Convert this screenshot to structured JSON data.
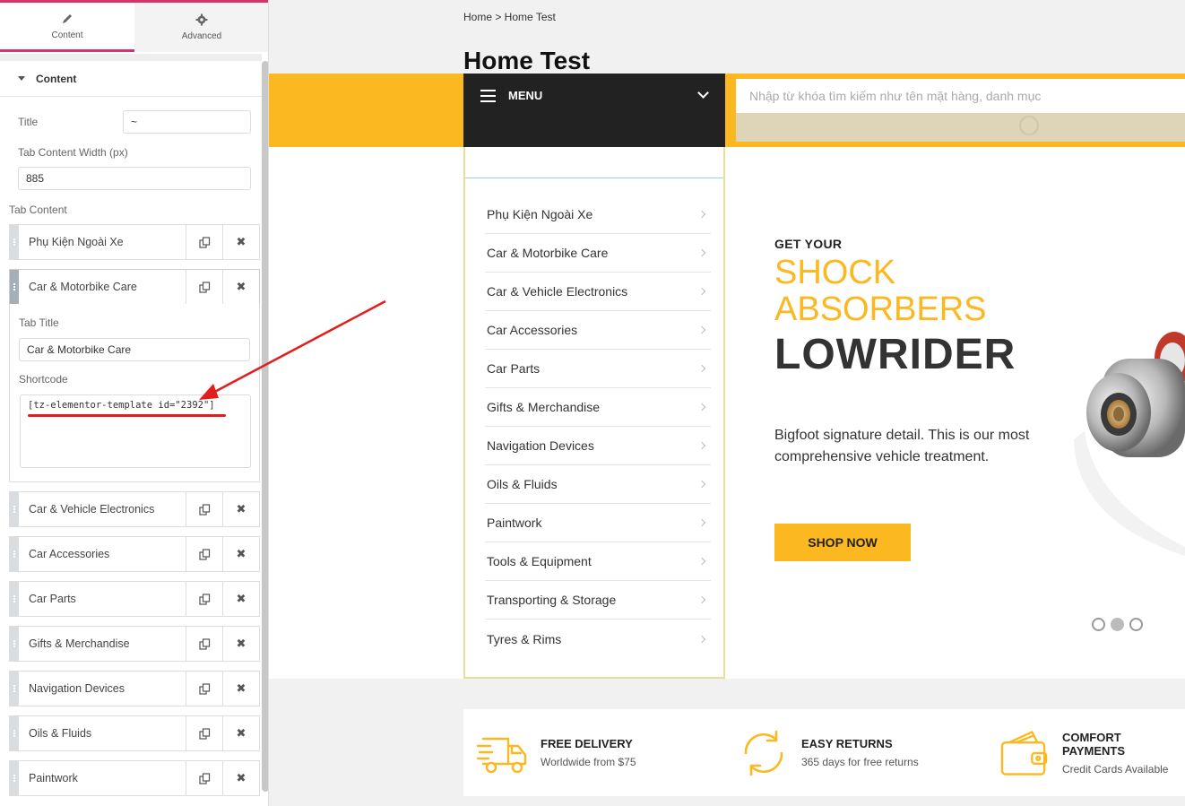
{
  "panel": {
    "tabs": [
      {
        "label": "Content",
        "icon": "pencil-icon"
      },
      {
        "label": "Advanced",
        "icon": "gear-icon"
      }
    ],
    "section_title": "Content",
    "title_label": "Title",
    "title_value": "~",
    "width_label": "Tab Content Width (px)",
    "width_value": "885",
    "tab_content_label": "Tab Content",
    "items": [
      {
        "title": "Phụ Kiện Ngoài Xe"
      },
      {
        "title": "Car & Motorbike Care"
      },
      {
        "title": "Car & Vehicle Electronics"
      },
      {
        "title": "Car Accessories"
      },
      {
        "title": "Car Parts"
      },
      {
        "title": "Gifts & Merchandise"
      },
      {
        "title": "Navigation Devices"
      },
      {
        "title": "Oils & Fluids"
      },
      {
        "title": "Paintwork"
      }
    ],
    "expanded": {
      "tab_title_label": "Tab Title",
      "tab_title_value": "Car & Motorbike Care",
      "shortcode_label": "Shortcode",
      "shortcode_value": "[tz-elementor-template id=\"2392\"]"
    }
  },
  "preview": {
    "breadcrumb": "Home > Home Test",
    "page_title": "Home Test",
    "menu_label": "MENU",
    "search_placeholder": "Nhập từ khóa tìm kiếm như tên mặt hàng, danh mục",
    "categories": [
      "Phụ Kiện Ngoài Xe",
      "Car & Motorbike Care",
      "Car & Vehicle Electronics",
      "Car Accessories",
      "Car Parts",
      "Gifts & Merchandise",
      "Navigation Devices",
      "Oils & Fluids",
      "Paintwork",
      "Tools & Equipment",
      "Transporting & Storage",
      "Tyres & Rims"
    ],
    "hero": {
      "kicker": "GET YOUR",
      "line1": "SHOCK",
      "line2": "ABSORBERS",
      "big": "LOWRIDER",
      "description": "Bigfoot signature detail. This is our most comprehensive vehicle treatment.",
      "button": "SHOP NOW"
    },
    "features": [
      {
        "title": "FREE DELIVERY",
        "subtitle": "Worldwide from $75",
        "icon": "truck-icon"
      },
      {
        "title": "EASY RETURNS",
        "subtitle": "365 days for free returns",
        "icon": "refresh-icon"
      },
      {
        "title": "COMFORT PAYMENTS",
        "subtitle": "Credit Cards Available",
        "icon": "wallet-icon"
      }
    ]
  },
  "colors": {
    "accent": "#fcb820",
    "editor_accent": "#d6336c",
    "annotation": "#e01e1e"
  }
}
